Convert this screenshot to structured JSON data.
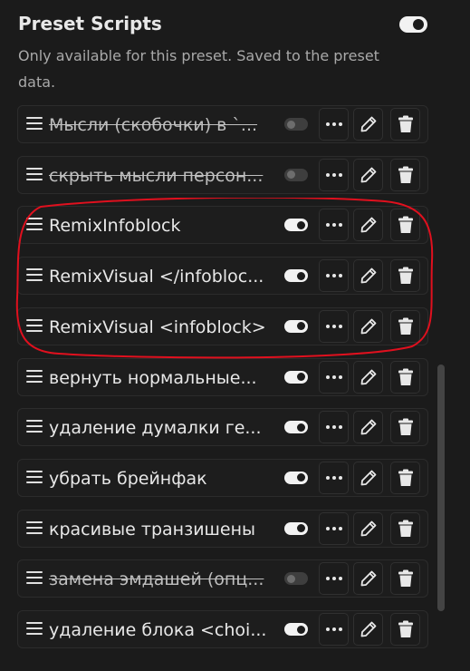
{
  "header": {
    "title": "Preset Scripts",
    "subtitle": "Only available for this preset. Saved to the preset data.",
    "toggle_on": true
  },
  "scripts": [
    {
      "label": "Мысли (скобочки) в `...",
      "enabled": false
    },
    {
      "label": "скрыть мысли персон...",
      "enabled": false
    },
    {
      "label": "RemixInfoblock",
      "enabled": true
    },
    {
      "label": "RemixVisual </infobloc...",
      "enabled": true
    },
    {
      "label": "RemixVisual <infoblock>",
      "enabled": true
    },
    {
      "label": "вернуть нормальные...",
      "enabled": true
    },
    {
      "label": "удаление думалки ге...",
      "enabled": true
    },
    {
      "label": "убрать брейнфак",
      "enabled": true
    },
    {
      "label": "красивые транзишены",
      "enabled": true
    },
    {
      "label": "замена эмдашей (опц...",
      "enabled": false
    },
    {
      "label": "удаление блока <choi...",
      "enabled": true
    }
  ],
  "icons": {
    "drag": "drag-handle-icon",
    "more": "more-icon",
    "edit": "pencil-icon",
    "delete": "trash-icon"
  },
  "colors": {
    "background": "#1b1b1b",
    "text": "#e8e8e8",
    "muted_text": "#a9a9a9",
    "annotation": "#e0101e"
  }
}
